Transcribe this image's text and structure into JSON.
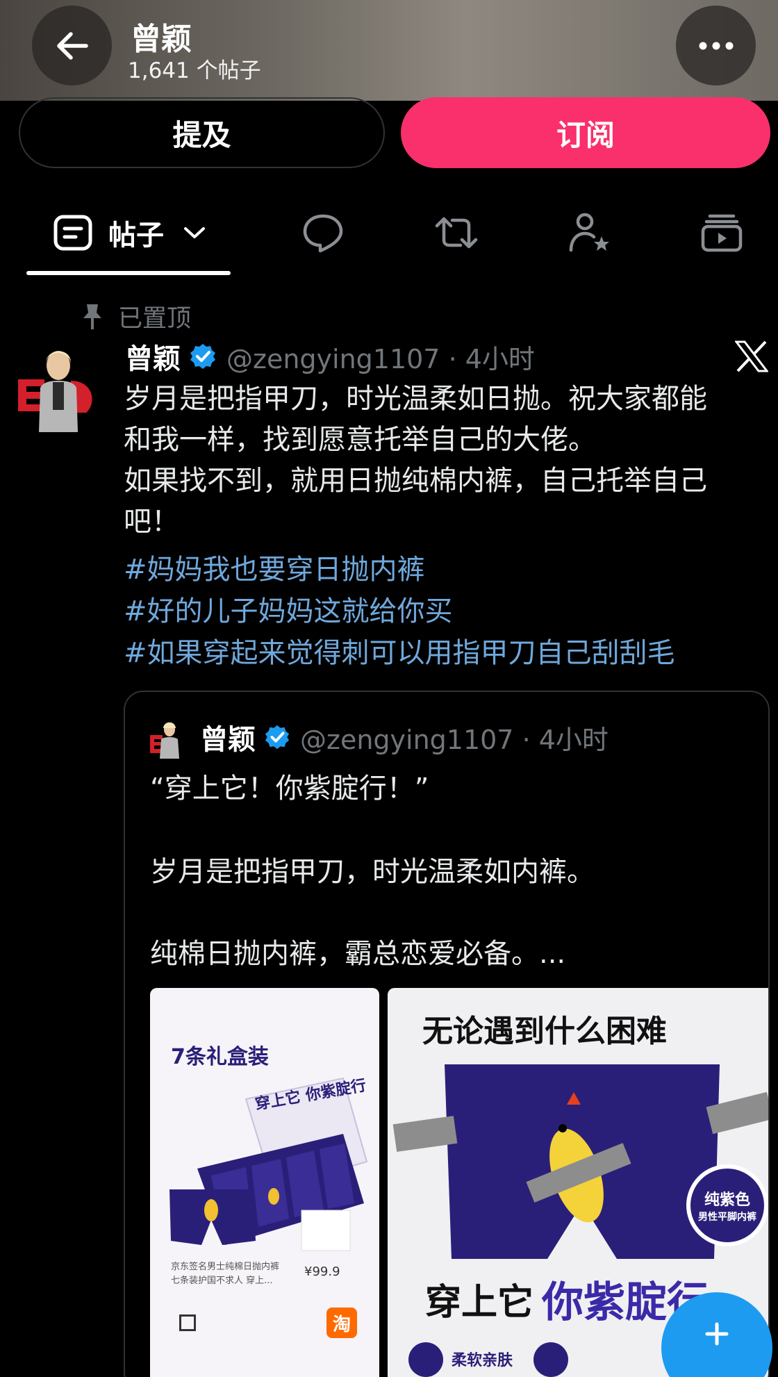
{
  "header": {
    "title": "曾颖",
    "post_count": "1,641 个帖子"
  },
  "actions": {
    "mention_label": "提及",
    "subscribe_label": "订阅"
  },
  "tabs": {
    "posts_label": "帖子"
  },
  "pinned_label": "已置顶",
  "post": {
    "author": "曾颖",
    "handle_time": "@zengying1107 · 4小时",
    "lines": [
      "岁月是把指甲刀，时光温柔如日抛。祝大家都能",
      "和我一样，找到愿意托举自己的大佬。",
      "如果找不到，就用日抛纯棉内裤，自己托举自己",
      "吧！"
    ],
    "hashtags": [
      "#妈妈我也要穿日抛内裤",
      "#好的儿子妈妈这就给你买",
      "#如果穿起来觉得刺可以用指甲刀自己刮刮毛"
    ]
  },
  "quoted": {
    "author": "曾颖",
    "handle_time": "@zengying1107 · 4小时",
    "line1": "“穿上它！你紫腚行！”",
    "line2": "岁月是把指甲刀，时光温柔如内裤。",
    "line3": "纯棉日抛内裤，霸总恋爱必备。..."
  },
  "product_left": {
    "headline": "7条礼盒装",
    "box_text": "穿上它 你紫腚行",
    "desc": "京东签名男士纯棉日抛内裤 七条装护国不求人 穿上...",
    "price": "¥99.9",
    "shop_badge": "淘"
  },
  "product_right": {
    "top_text": "无论遇到什么困难",
    "badge_line1": "纯紫色",
    "badge_line2": "男性平脚内裤",
    "bottom_text_a": "穿上它",
    "bottom_text_b": "你紫腚行",
    "feature1": "柔软亲肤"
  },
  "colors": {
    "accent_pink": "#f9306c",
    "link_blue": "#6fa8dc",
    "verified_blue": "#1d9bf0",
    "muted": "#71767b",
    "product_purple": "#2a1f78"
  }
}
